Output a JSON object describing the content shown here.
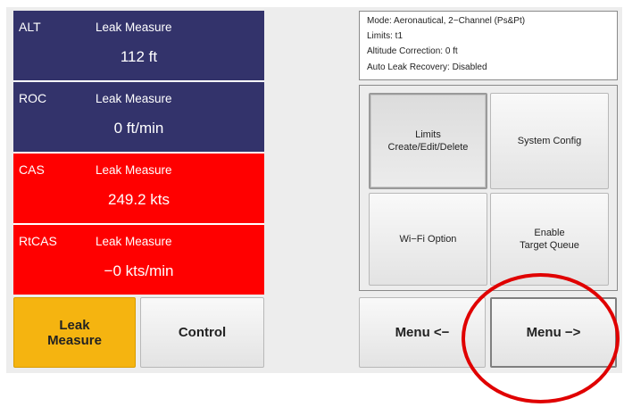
{
  "panels": [
    {
      "name": "ALT",
      "mode": "Leak Measure",
      "value": "112 ft"
    },
    {
      "name": "ROC",
      "mode": "Leak Measure",
      "value": "0 ft/min"
    },
    {
      "name": "CAS",
      "mode": "Leak Measure",
      "value": "249.2 kts"
    },
    {
      "name": "RtCAS",
      "mode": "Leak Measure",
      "value": "−0 kts/min"
    }
  ],
  "panel_colors": {
    "blue": "#33336b",
    "red": "#ff0000"
  },
  "bottom_buttons": {
    "leak_measure": "Leak\nMeasure",
    "control": "Control"
  },
  "info": {
    "mode": "Mode: Aeronautical, 2−Channel (Ps&Pt)",
    "limits": "Limits: t1",
    "altitude_correction": "Altitude Correction: 0 ft",
    "auto_leak_recovery": "Auto Leak Recovery: Disabled"
  },
  "menu_buttons": {
    "limits": "Limits\nCreate/Edit/Delete",
    "system_config": "System Config",
    "wifi_option": "Wi−Fi Option",
    "enable_target_queue": "Enable\nTarget Queue"
  },
  "nav": {
    "menu_prev": "Menu <−",
    "menu_next": "Menu −>"
  },
  "annotation": {
    "color": "#e00000",
    "target": "Menu −>"
  }
}
